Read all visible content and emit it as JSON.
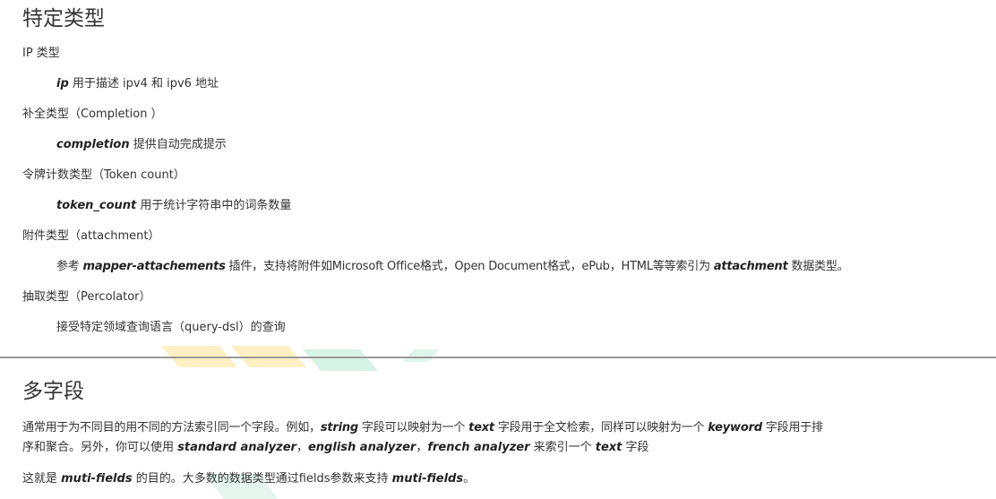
{
  "special_types": {
    "title": "特定类型",
    "ip": {
      "heading": "IP 类型",
      "kw": "ip",
      "desc": " 用于描述 ipv4 和 ipv6 地址"
    },
    "completion": {
      "heading": "补全类型（Completion ）",
      "kw": "completion",
      "desc": " 提供自动完成提示"
    },
    "token_count": {
      "heading": "令牌计数类型（Token count）",
      "kw": "token_count",
      "desc": " 用于统计字符串中的词条数量"
    },
    "attachment": {
      "heading": "附件类型（attachment）",
      "pre": "参考 ",
      "kw1": "mapper-attachements",
      "mid": " 插件，支持将附件如Microsoft Office格式，Open Document格式，ePub，HTML等等索引为 ",
      "kw2": "attachment",
      "post": " 数据类型。"
    },
    "percolator": {
      "heading": "抽取类型（Percolator）",
      "desc": "接受特定领域查询语言（query-dsl）的查询"
    }
  },
  "multi_fields": {
    "title": "多字段",
    "p1": {
      "a": "通常用于为不同目的用不同的方法索引同一个字段。例如，",
      "kw_string": "string",
      "b": " 字段可以映射为一个 ",
      "kw_text": "text",
      "c": " 字段用于全文检索，同样可以映射为一个 ",
      "kw_keyword": "keyword",
      "d": " 字段用于排",
      "line2_a": "序和聚合。另外，你可以使用 ",
      "kw_standard": "standard analyzer",
      "sep1": "，",
      "kw_english": "english analyzer",
      "sep2": "，",
      "kw_french": "french analyzer",
      "line2_b": " 来索引一个 ",
      "kw_text2": "text",
      "line2_c": " 字段"
    },
    "p2": {
      "a": "这就是 ",
      "kw1": "muti-fields",
      "b": " 的目的。大多数的数据类型通过fields参数来支持 ",
      "kw2": "muti-fields",
      "c": "。"
    }
  },
  "colors": {
    "watermark_yellow": "#fde9b0",
    "watermark_green": "#c9eedd",
    "divider": "#9a9a9a"
  }
}
